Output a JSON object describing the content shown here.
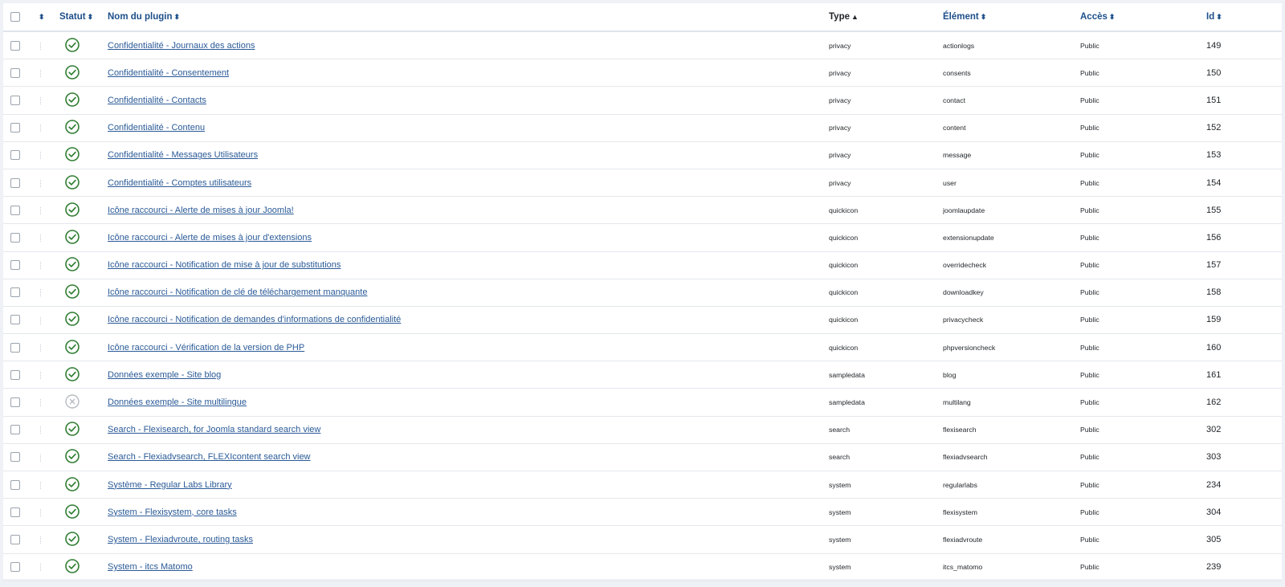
{
  "header": {
    "status": "Statut",
    "name": "Nom du plugin",
    "type": "Type",
    "element": "Élément",
    "access": "Accès",
    "id": "Id",
    "sort_both_icon": "sort-both-icon",
    "sort_up_icon": "sort-up-icon"
  },
  "colors": {
    "enabled": "#2f7d32",
    "disabled": "#b7bcc3",
    "link": "#2a5a97"
  },
  "rows": [
    {
      "name": "Confidentialité - Journaux des actions",
      "type": "privacy",
      "element": "actionlogs",
      "access": "Public",
      "id": "149",
      "enabled": true
    },
    {
      "name": "Confidentialité - Consentement",
      "type": "privacy",
      "element": "consents",
      "access": "Public",
      "id": "150",
      "enabled": true
    },
    {
      "name": "Confidentialité - Contacts",
      "type": "privacy",
      "element": "contact",
      "access": "Public",
      "id": "151",
      "enabled": true
    },
    {
      "name": "Confidentialité - Contenu",
      "type": "privacy",
      "element": "content",
      "access": "Public",
      "id": "152",
      "enabled": true
    },
    {
      "name": "Confidentialité - Messages Utilisateurs",
      "type": "privacy",
      "element": "message",
      "access": "Public",
      "id": "153",
      "enabled": true
    },
    {
      "name": "Confidentialité - Comptes utilisateurs",
      "type": "privacy",
      "element": "user",
      "access": "Public",
      "id": "154",
      "enabled": true
    },
    {
      "name": "Icône raccourci - Alerte de mises à jour Joomla!",
      "type": "quickicon",
      "element": "joomlaupdate",
      "access": "Public",
      "id": "155",
      "enabled": true
    },
    {
      "name": "Icône raccourci - Alerte de mises à jour d'extensions",
      "type": "quickicon",
      "element": "extensionupdate",
      "access": "Public",
      "id": "156",
      "enabled": true
    },
    {
      "name": "Icône raccourci - Notification de mise à jour de substitutions",
      "type": "quickicon",
      "element": "overridecheck",
      "access": "Public",
      "id": "157",
      "enabled": true
    },
    {
      "name": "Icône raccourci - Notification de clé de téléchargement manquante",
      "type": "quickicon",
      "element": "downloadkey",
      "access": "Public",
      "id": "158",
      "enabled": true
    },
    {
      "name": "Icône raccourci - Notification de demandes d'informations de confidentialité",
      "type": "quickicon",
      "element": "privacycheck",
      "access": "Public",
      "id": "159",
      "enabled": true
    },
    {
      "name": "Icône raccourci - Vérification de la version de PHP",
      "type": "quickicon",
      "element": "phpversioncheck",
      "access": "Public",
      "id": "160",
      "enabled": true
    },
    {
      "name": "Données exemple - Site blog",
      "type": "sampledata",
      "element": "blog",
      "access": "Public",
      "id": "161",
      "enabled": true
    },
    {
      "name": "Données exemple - Site multilingue",
      "type": "sampledata",
      "element": "multilang",
      "access": "Public",
      "id": "162",
      "enabled": false
    },
    {
      "name": "Search - Flexisearch, for Joomla standard search view",
      "type": "search",
      "element": "flexisearch",
      "access": "Public",
      "id": "302",
      "enabled": true
    },
    {
      "name": "Search - Flexiadvsearch, FLEXIcontent search view",
      "type": "search",
      "element": "flexiadvsearch",
      "access": "Public",
      "id": "303",
      "enabled": true
    },
    {
      "name": "Système - Regular Labs Library",
      "type": "system",
      "element": "regularlabs",
      "access": "Public",
      "id": "234",
      "enabled": true
    },
    {
      "name": "System - Flexisystem, core tasks",
      "type": "system",
      "element": "flexisystem",
      "access": "Public",
      "id": "304",
      "enabled": true
    },
    {
      "name": "System - Flexiadvroute, routing tasks",
      "type": "system",
      "element": "flexiadvroute",
      "access": "Public",
      "id": "305",
      "enabled": true
    },
    {
      "name": "System - itcs Matomo",
      "type": "system",
      "element": "itcs_matomo",
      "access": "Public",
      "id": "239",
      "enabled": true
    }
  ]
}
